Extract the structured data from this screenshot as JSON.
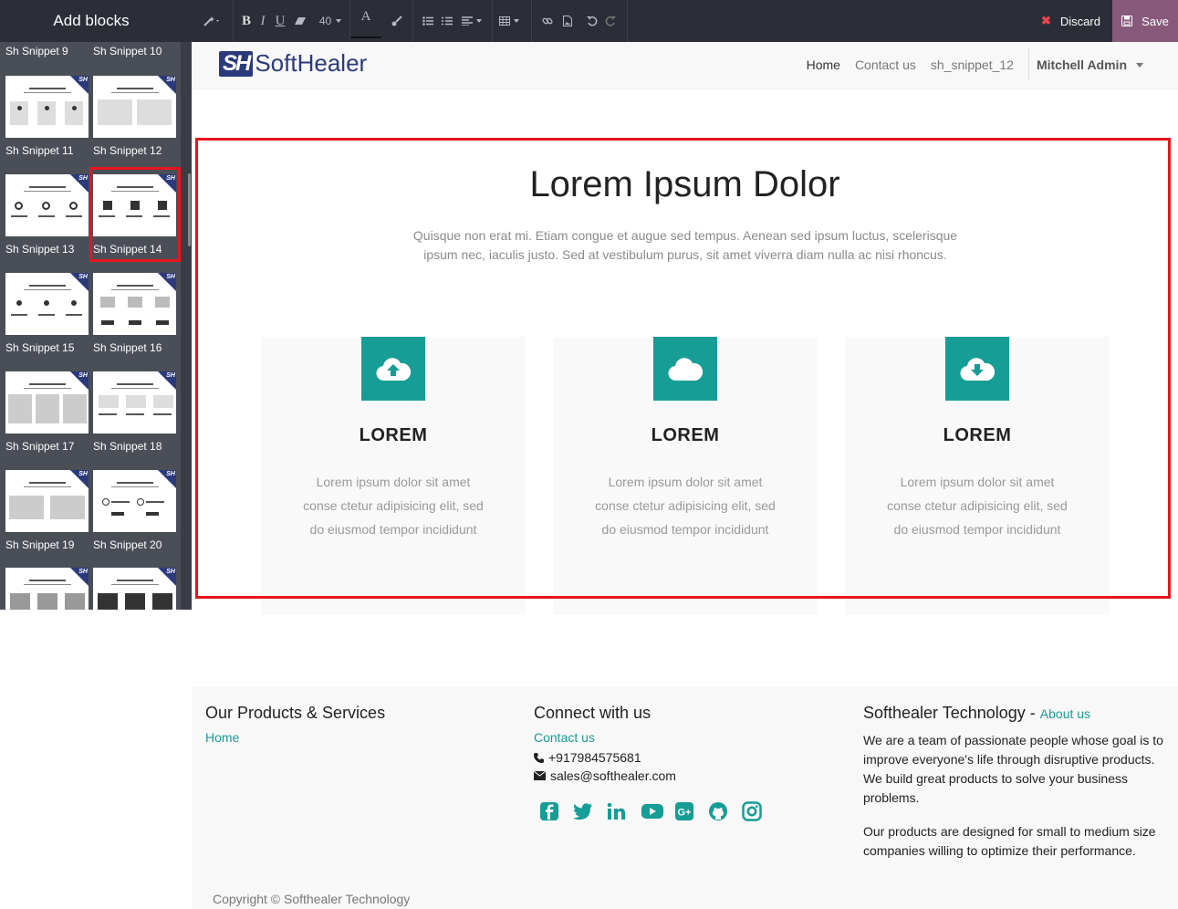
{
  "sidebar": {
    "title": "Add blocks",
    "snippets": [
      {
        "label": "Sh Snippet 9"
      },
      {
        "label": "Sh Snippet 10"
      },
      {
        "label": "Sh Snippet 11"
      },
      {
        "label": "Sh Snippet 12"
      },
      {
        "label": "Sh Snippet 13"
      },
      {
        "label": "Sh Snippet 14"
      },
      {
        "label": "Sh Snippet 15"
      },
      {
        "label": "Sh Snippet 16"
      },
      {
        "label": "Sh Snippet 17"
      },
      {
        "label": "Sh Snippet 18"
      },
      {
        "label": "Sh Snippet 19"
      },
      {
        "label": "Sh Snippet 20"
      }
    ],
    "thumb_badge": "SH"
  },
  "toolbar": {
    "font_size": "40",
    "discard_label": "Discard",
    "save_label": "Save",
    "save_color": "#875a7b"
  },
  "header": {
    "logo_mark": "SH",
    "logo_word": "SoftHealer",
    "nav": [
      "Home",
      "Contact us",
      "sh_snippet_12"
    ],
    "user": "Mitchell Admin"
  },
  "main": {
    "title": "Lorem Ipsum Dolor",
    "subtitle": "Quisque non erat mi. Etiam congue et augue sed tempus. Aenean sed ipsum luctus, scelerisque ipsum nec, iaculis justo. Sed at vestibulum purus, sit amet viverra diam nulla ac nisi rhoncus.",
    "accent": "#169d96",
    "cards": [
      {
        "title": "LOREM",
        "text": "Lorem ipsum dolor sit amet conse ctetur adipisicing elit, sed do eiusmod tempor incididunt",
        "icon": "cloud-upload-icon"
      },
      {
        "title": "LOREM",
        "text": "Lorem ipsum dolor sit amet conse ctetur adipisicing elit, sed do eiusmod tempor incididunt",
        "icon": "cloud-icon"
      },
      {
        "title": "LOREM",
        "text": "Lorem ipsum dolor sit amet conse ctetur adipisicing elit, sed do eiusmod tempor incididunt",
        "icon": "cloud-download-icon"
      }
    ]
  },
  "footer": {
    "col1": {
      "heading": "Our Products & Services",
      "link": "Home"
    },
    "col2": {
      "heading": "Connect with us",
      "link": "Contact us",
      "phone": "+917984575681",
      "email": "sales@softhealer.com"
    },
    "col3": {
      "heading": "Softhealer Technology",
      "sep": " - ",
      "link": "About us",
      "p1": "We are a team of passionate people whose goal is to improve everyone's life through disruptive products. We build great products to solve your business problems.",
      "p2": "Our products are designed for small to medium size companies willing to optimize their performance."
    },
    "copyright": "Copyright © Softhealer Technology"
  }
}
